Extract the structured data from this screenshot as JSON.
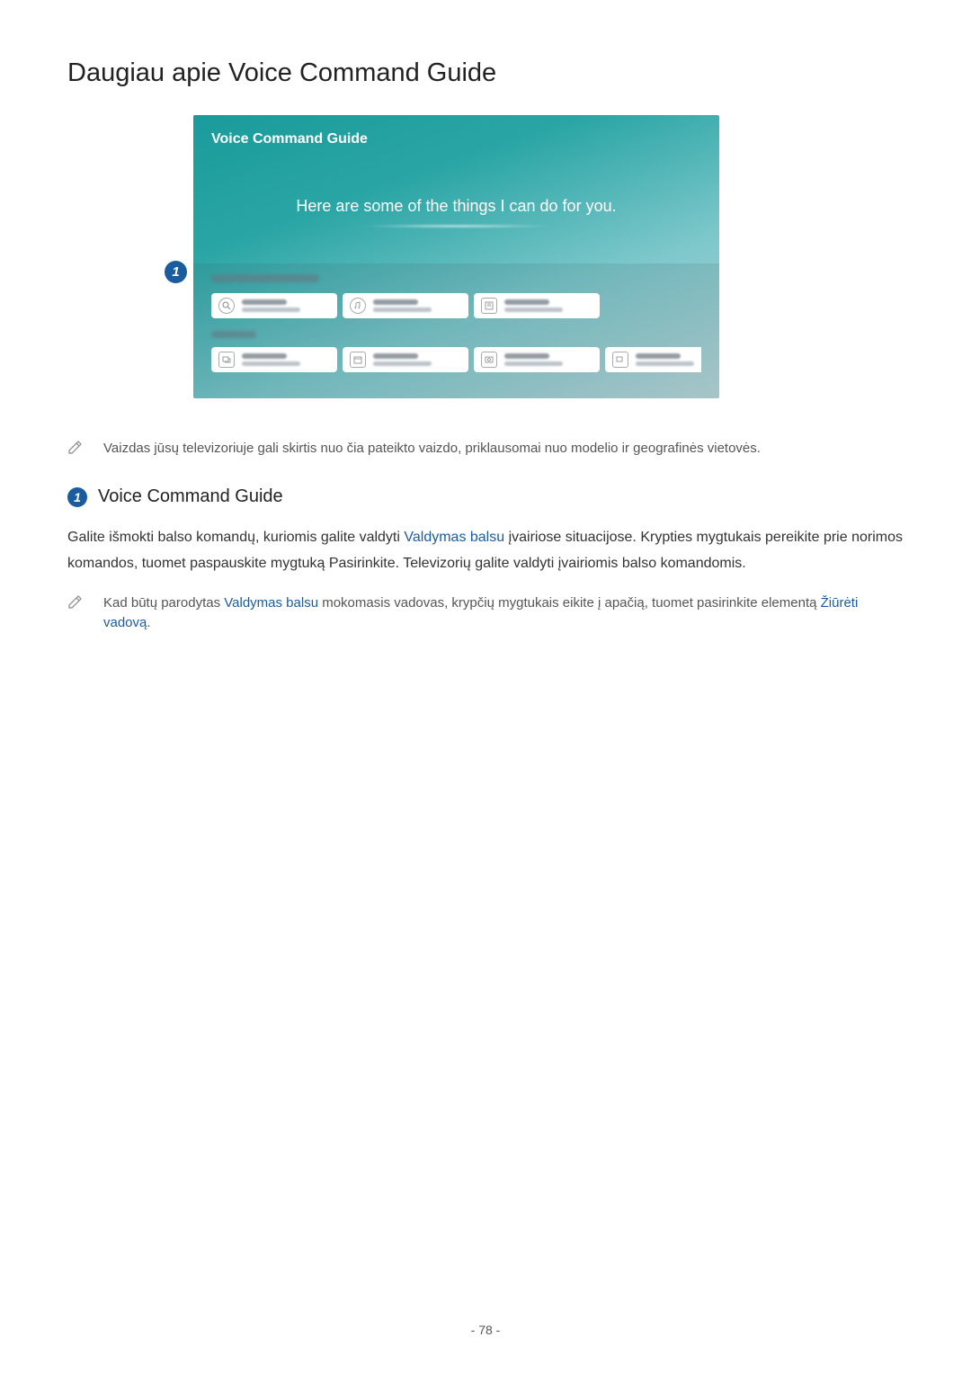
{
  "heading": "Daugiau apie Voice Command Guide",
  "screenshot": {
    "title": "Voice Command Guide",
    "subtitle": "Here are some of the things I can do for you.",
    "badge_number": "1"
  },
  "note1": "Vaizdas jūsų televizoriuje gali skirtis nuo čia pateikto vaizdo, priklausomai nuo modelio ir geografinės vietovės.",
  "section": {
    "badge_number": "1",
    "heading": "Voice Command Guide",
    "body_pre": "Galite išmokti balso komandų, kuriomis galite valdyti ",
    "body_link1": "Valdymas balsu",
    "body_post": " įvairiose situacijose. Krypties mygtukais pereikite prie norimos komandos, tuomet paspauskite mygtuką Pasirinkite. Televizorių galite valdyti įvairiomis balso komandomis."
  },
  "note2": {
    "pre": "Kad būtų parodytas ",
    "link1": "Valdymas balsu",
    "mid": " mokomasis vadovas, krypčių mygtukais eikite į apačią, tuomet pasirinkite elementą ",
    "link2": "Žiūrėti vadovą",
    "post": "."
  },
  "page_number": "- 78 -"
}
